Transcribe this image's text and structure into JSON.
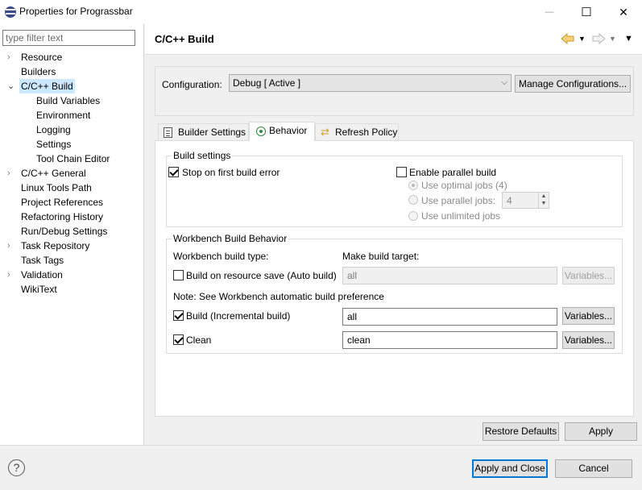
{
  "window": {
    "title": "Properties for Prograssbar",
    "minimize_glyph": "—",
    "maximize_glyph": "☐",
    "close_glyph": "✕"
  },
  "sidebar": {
    "filter_placeholder": "type filter text",
    "items": [
      {
        "label": "Resource",
        "expandable": true,
        "expanded": false
      },
      {
        "label": "Builders"
      },
      {
        "label": "C/C++ Build",
        "expandable": true,
        "expanded": true,
        "selected": true
      },
      {
        "label": "Build Variables",
        "child": true
      },
      {
        "label": "Environment",
        "child": true
      },
      {
        "label": "Logging",
        "child": true
      },
      {
        "label": "Settings",
        "child": true
      },
      {
        "label": "Tool Chain Editor",
        "child": true
      },
      {
        "label": "C/C++ General",
        "expandable": true,
        "expanded": false
      },
      {
        "label": "Linux Tools Path"
      },
      {
        "label": "Project References"
      },
      {
        "label": "Refactoring History"
      },
      {
        "label": "Run/Debug Settings"
      },
      {
        "label": "Task Repository",
        "expandable": true,
        "expanded": false
      },
      {
        "label": "Task Tags"
      },
      {
        "label": "Validation",
        "expandable": true,
        "expanded": false
      },
      {
        "label": "WikiText"
      }
    ]
  },
  "header": {
    "title": "C/C++ Build",
    "back_icon": "back-arrow-icon",
    "forward_icon": "forward-arrow-icon",
    "menu_icon": "view-menu-icon"
  },
  "configuration": {
    "label": "Configuration:",
    "value": "Debug  [ Active ]",
    "manage_button": "Manage Configurations..."
  },
  "tabs": [
    {
      "label": "Builder Settings",
      "icon": "builder-settings-icon"
    },
    {
      "label": "Behavior",
      "icon": "behavior-icon",
      "active": true
    },
    {
      "label": "Refresh Policy",
      "icon": "refresh-policy-icon"
    }
  ],
  "build_settings": {
    "title": "Build settings",
    "stop_on_first_error": {
      "label": "Stop on first build error",
      "checked": true
    },
    "enable_parallel": {
      "label": "Enable parallel build",
      "checked": false
    },
    "use_optimal_jobs": "Use optimal jobs (4)",
    "use_parallel_jobs": "Use parallel jobs:",
    "parallel_jobs_value": "4",
    "use_unlimited_jobs": "Use unlimited jobs"
  },
  "workbench": {
    "title": "Workbench Build Behavior",
    "build_type_label": "Workbench build type:",
    "make_target_label": "Make build target:",
    "auto_build": {
      "label": "Build on resource save (Auto build)",
      "checked": false,
      "target": "all",
      "variables": "Variables..."
    },
    "note": "Note: See Workbench automatic build preference",
    "incremental": {
      "label": "Build (Incremental build)",
      "checked": true,
      "target": "all",
      "variables": "Variables..."
    },
    "clean": {
      "label": "Clean",
      "checked": true,
      "target": "clean",
      "variables": "Variables..."
    }
  },
  "actions": {
    "restore_defaults": "Restore Defaults",
    "apply": "Apply"
  },
  "footer": {
    "help_glyph": "?",
    "apply_and_close": "Apply and Close",
    "cancel": "Cancel"
  }
}
